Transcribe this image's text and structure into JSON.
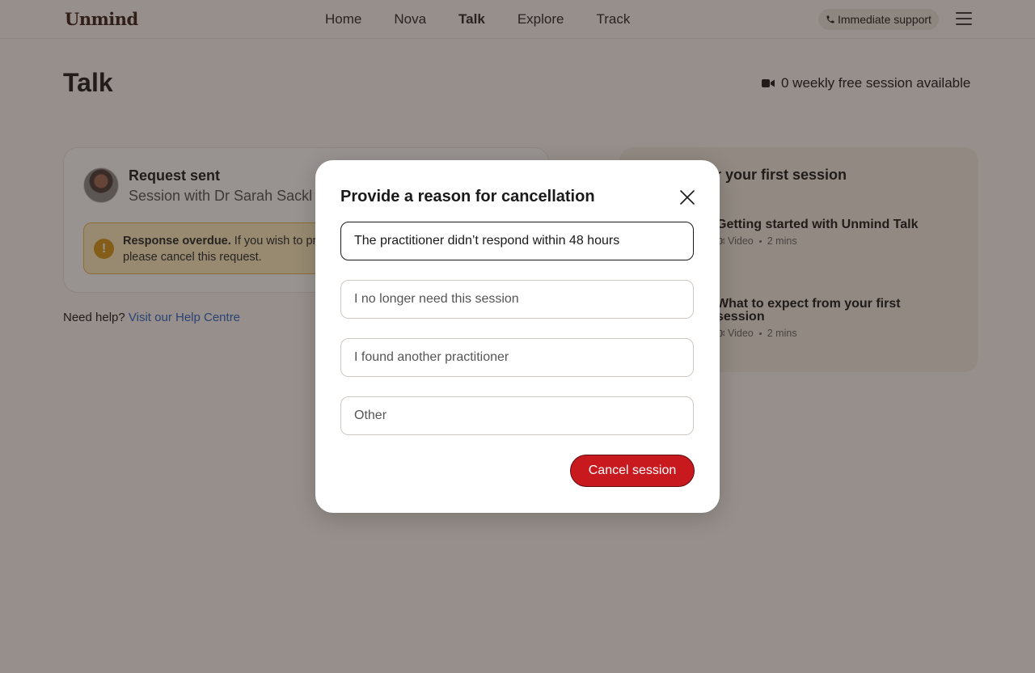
{
  "header": {
    "logo": "Unmind",
    "nav": [
      "Home",
      "Nova",
      "Talk",
      "Explore",
      "Track"
    ],
    "active_nav": "Talk",
    "support_label": "Immediate support"
  },
  "page": {
    "title": "Talk",
    "sessions_available": "0 weekly free session available"
  },
  "request_card": {
    "title": "Request sent",
    "subtitle": "Session with Dr Sarah Sackl",
    "warning_bold": "Response overdue.",
    "warning_text": " If you wish to pr",
    "warning_text_2": "please cancel this request."
  },
  "help": {
    "prefix": "Need help?",
    "link": "Visit our Help Centre"
  },
  "first_session_card": {
    "title": "or your first session",
    "items": [
      {
        "title": "Getting started with Unmind Talk",
        "type": "Video",
        "duration": "2 mins"
      },
      {
        "title": "What to expect from your first session",
        "title_line1": "What to expect from your first",
        "title_line2": "session",
        "type": "Video",
        "duration": "2 mins"
      }
    ]
  },
  "modal": {
    "title": "Provide a reason for cancellation",
    "options": [
      "The practitioner didn’t respond within 48 hours",
      "I no longer need this session",
      "I found another practitioner",
      "Other"
    ],
    "selected_index": 0,
    "cancel_label": "Cancel session"
  },
  "colors": {
    "background": "#fbf7f3",
    "accent_red": "#c8191f",
    "warning_bg": "#fdeec2",
    "warning_icon": "#d99a1a",
    "link": "#2f65c8"
  }
}
